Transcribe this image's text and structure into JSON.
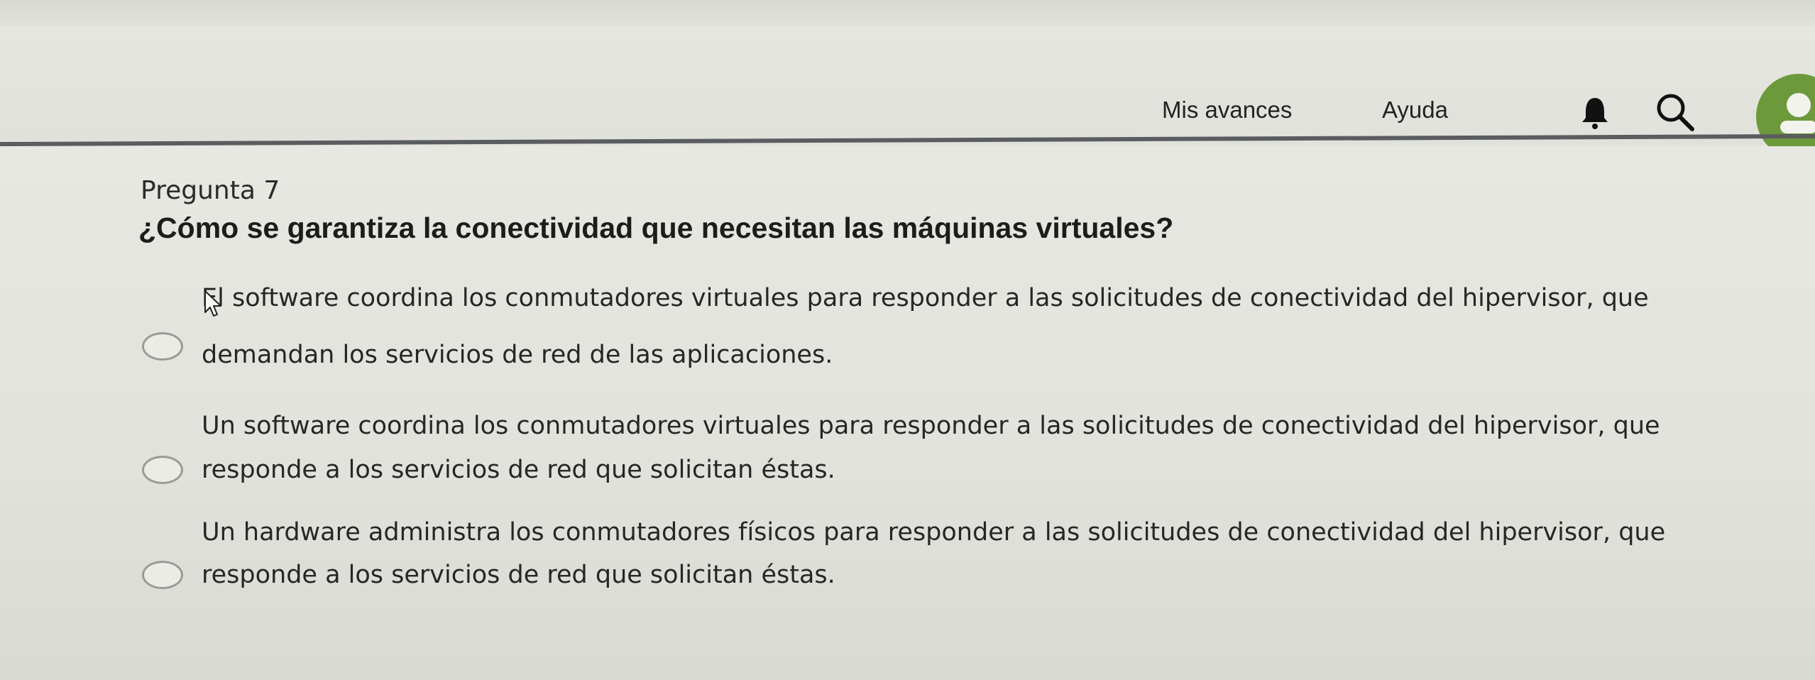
{
  "header": {
    "nav": {
      "progress_label": "Mis avances",
      "help_label": "Ayuda"
    },
    "icons": [
      "bell-icon",
      "search-icon",
      "user-avatar-icon"
    ],
    "avatar_color": "#6c9a3a"
  },
  "question": {
    "number_label": "Pregunta 7",
    "text": "¿Cómo se garantiza la conectividad que necesitan las máquinas virtuales?",
    "options": [
      {
        "line1": "El software coordina los conmutadores virtuales para responder a las solicitudes de conectividad del hipervisor, que",
        "line2": "demandan los servicios de red de las aplicaciones."
      },
      {
        "line1": "Un software coordina los conmutadores virtuales para responder a las solicitudes de conectividad del hipervisor, que",
        "line2": "responde a los servicios de red que solicitan éstas."
      },
      {
        "line1": "Un hardware administra los conmutadores físicos para responder a las solicitudes de conectividad del hipervisor, que",
        "line2": "responde a los servicios de red que solicitan éstas."
      }
    ]
  }
}
